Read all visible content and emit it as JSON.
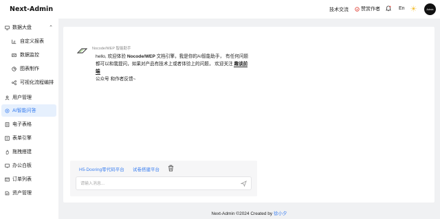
{
  "header": {
    "logo": "Next-Admin",
    "tech_exchange": "技术交流",
    "sponsor": "赞赏作者",
    "language": "En",
    "avatar_text": "Admin"
  },
  "sidebar": {
    "items": [
      {
        "label": "数据大盘",
        "icon": "monitor-icon"
      },
      {
        "label": "自定义报表",
        "icon": "bar-chart-icon"
      },
      {
        "label": "数据监控",
        "icon": "monitor-line-icon"
      },
      {
        "label": "图表制作",
        "icon": "pie-chart-icon"
      },
      {
        "label": "可视化流程编排",
        "icon": "flow-icon"
      },
      {
        "label": "用户管理",
        "icon": "user-icon"
      },
      {
        "label": "AI智能问答",
        "icon": "ai-icon"
      },
      {
        "label": "电子表格",
        "icon": "sheet-icon"
      },
      {
        "label": "表单引擎",
        "icon": "form-icon"
      },
      {
        "label": "拖拽搭建",
        "icon": "drag-icon"
      },
      {
        "label": "办公白板",
        "icon": "whiteboard-icon"
      },
      {
        "label": "订单列表",
        "icon": "order-icon"
      },
      {
        "label": "资产管理",
        "icon": "asset-icon"
      }
    ]
  },
  "chat": {
    "bot_name": "Nocode/WEP 智能助手",
    "message_prefix": "hello, 欢迎体验 ",
    "message_brand": "Nocode/WEP",
    "message_mid": " 文档引擎，我是你的AI智能助手， 有任何问题都可以和我提问，如果对产品有技术上或者体验上的问题， 欢迎关注 ",
    "message_link": "趣谈前端",
    "message_suffix": "公众号 和作者反馈~",
    "quick_1": "H5-Dooring零代码平台",
    "quick_2": "试卷搭建平台",
    "input_placeholder": "请输入消息..."
  },
  "footer": {
    "text": "Next-Admin ©2024 Created by ",
    "author": "徐小夕"
  },
  "colors": {
    "accent": "#3b7ff0",
    "active_bg": "#e6f0fd",
    "page_bg": "#f0f1f3"
  }
}
